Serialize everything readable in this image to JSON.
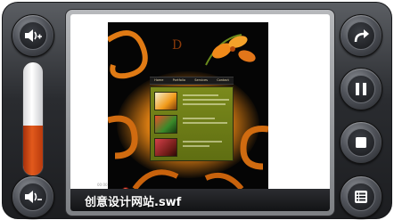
{
  "player": {
    "filename": "创意设计网站.swf",
    "volume_level": 0.44,
    "progress": 0.2,
    "time_label": "00:00"
  },
  "preview": {
    "nav_items": [
      "Home",
      "Portfolio",
      "Services",
      "Contact"
    ]
  },
  "controls": {
    "left": [
      "volume-up-icon",
      "volume-down-icon"
    ],
    "right": [
      "replay-icon",
      "pause-icon",
      "stop-icon",
      "playlist-icon"
    ]
  },
  "colors": {
    "accent": "#e0321e",
    "volume_fill": "#d9521a",
    "chrome": "#2a2c30"
  }
}
